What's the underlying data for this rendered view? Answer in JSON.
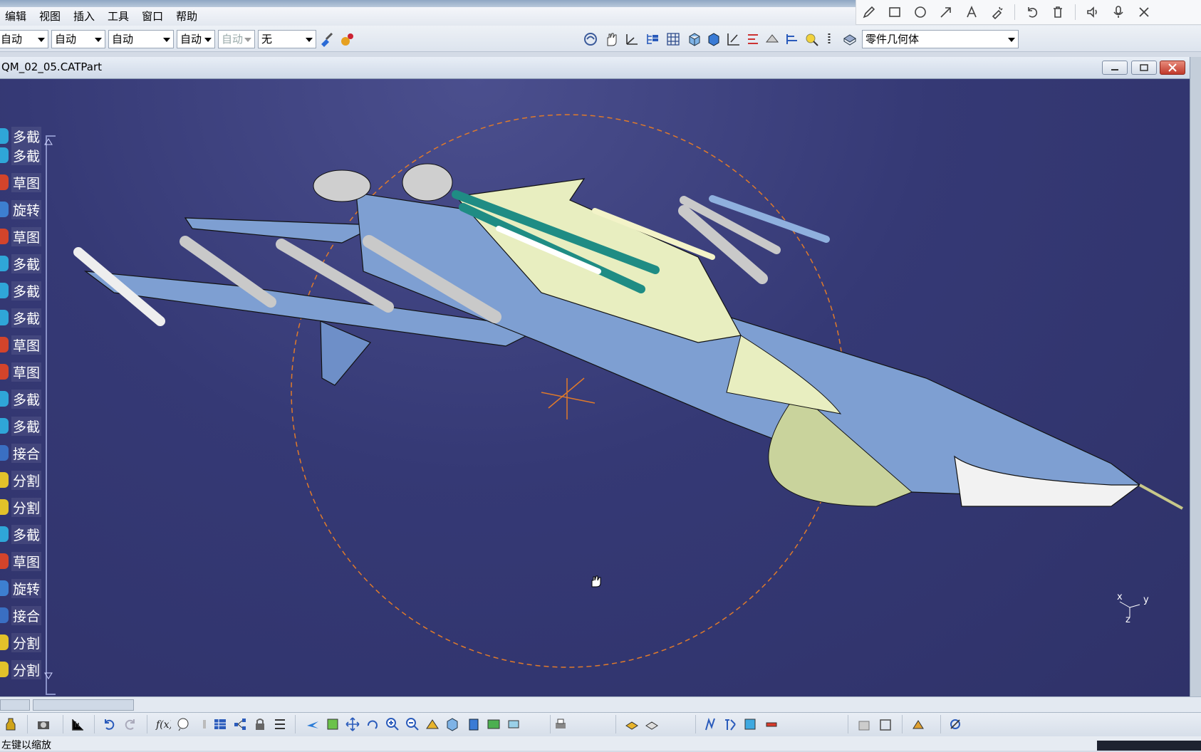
{
  "menu": {
    "items": [
      "编辑",
      "视图",
      "插入",
      "工具",
      "窗口",
      "帮助"
    ]
  },
  "toolbar": {
    "dropdowns": [
      {
        "value": "自动"
      },
      {
        "value": "自动"
      },
      {
        "value": "自动"
      },
      {
        "value": "自动"
      },
      {
        "value": "自动"
      },
      {
        "value": "无"
      }
    ],
    "geometry_select": "零件几何体"
  },
  "document": {
    "title": "QM_02_05.CATPart"
  },
  "tree": {
    "items": [
      {
        "label": "多截",
        "icon": "multi-section-icon"
      },
      {
        "label": "多截",
        "icon": "multi-section-icon"
      },
      {
        "label": "草图",
        "icon": "sketch-icon"
      },
      {
        "label": "旋转",
        "icon": "revolve-icon"
      },
      {
        "label": "草图",
        "icon": "sketch-icon"
      },
      {
        "label": "多截",
        "icon": "multi-section-icon"
      },
      {
        "label": "多截",
        "icon": "multi-section-icon"
      },
      {
        "label": "多截",
        "icon": "multi-section-icon"
      },
      {
        "label": "草图",
        "icon": "sketch-icon"
      },
      {
        "label": "草图",
        "icon": "sketch-icon"
      },
      {
        "label": "多截",
        "icon": "multi-section-icon"
      },
      {
        "label": "多截",
        "icon": "multi-section-icon"
      },
      {
        "label": "接合",
        "icon": "join-icon"
      },
      {
        "label": "分割",
        "icon": "split-icon"
      },
      {
        "label": "分割",
        "icon": "split-icon"
      },
      {
        "label": "多截",
        "icon": "multi-section-icon"
      },
      {
        "label": "草图",
        "icon": "sketch-icon"
      },
      {
        "label": "旋转",
        "icon": "revolve-icon"
      },
      {
        "label": "接合",
        "icon": "join-icon"
      },
      {
        "label": "分割",
        "icon": "split-icon"
      },
      {
        "label": "分割",
        "icon": "split-icon"
      }
    ]
  },
  "compass": {
    "x_label": "x",
    "y_label": "y",
    "z_label": "z"
  },
  "status": {
    "text": "左键以缩放"
  },
  "colors": {
    "viewport": "#333771",
    "fuselage_blue": "#7e9fd2",
    "wing_yellow": "#e8eec0",
    "missile_teal": "#1f8c84",
    "rotation_circle": "#e07a2a"
  }
}
